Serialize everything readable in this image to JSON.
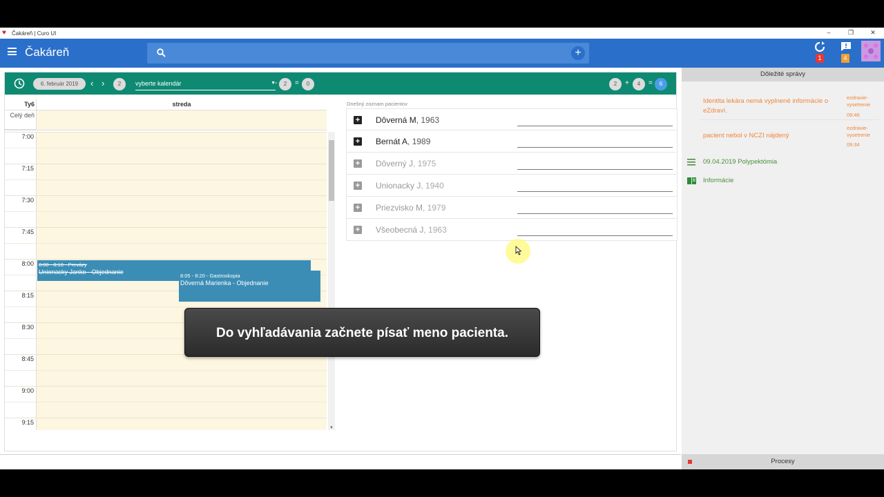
{
  "window": {
    "title": "Čakáreň | Curo UI",
    "controls": [
      "–",
      "❐",
      "✕"
    ]
  },
  "appbar": {
    "title": "Čakáreň",
    "search_placeholder": "",
    "sync_badge": "1",
    "messages_badge": "4"
  },
  "toolbar": {
    "date": "6. február 2019",
    "week_count": "2",
    "calendar_select": "vyberte kalendár",
    "filter_a": "2",
    "filter_eq": "0",
    "count_a": "2",
    "count_b": "4",
    "count_total": "6",
    "minus": "-",
    "equals": "=",
    "plus": "+"
  },
  "calendar": {
    "week_label": "Ty6",
    "day_label": "streda",
    "allday_label": "Celý deň",
    "times": [
      "7:00",
      "7:15",
      "7:30",
      "7:45",
      "8:00",
      "8:15",
      "8:30",
      "8:45",
      "9:00",
      "9:15"
    ],
    "events": [
      {
        "time": "8:00 - 8:10 - Prevázy",
        "name": "Unionacky Janko - Objednanie",
        "cancelled": true
      },
      {
        "time": "8:05 - 8:20 - Gastroskopia",
        "name": "Dôverná Marienka - Objednanie",
        "cancelled": false
      }
    ]
  },
  "patients": {
    "caption": "Dnešný zoznam pacientov",
    "items": [
      {
        "name": "Dôverná M",
        "year": ", 1963",
        "active": true
      },
      {
        "name": "Bernát A",
        "year": ", 1989",
        "active": true
      },
      {
        "name": "Dôverný J",
        "year": ", 1975",
        "active": false
      },
      {
        "name": "Unionacky J",
        "year": ", 1940",
        "active": false
      },
      {
        "name": "Priezvisko M",
        "year": ", 1979",
        "active": false
      },
      {
        "name": "Všeobecná J",
        "year": ", 1963",
        "active": false
      }
    ]
  },
  "messages": {
    "title": "Dôležité správy",
    "items": [
      {
        "text": "Identita lekára nemá vyplnené informácie o eZdraví.",
        "source": "ezdravie-vysetrenie",
        "time": "09:46"
      },
      {
        "text": "pacient nebol v NCZI nájdený",
        "source": "ezdravie-vysetrenie",
        "time": "09:34"
      }
    ],
    "links": [
      {
        "text": "09.04.2019 Polypektómia",
        "icon": "list-icon"
      },
      {
        "text": "Informácie",
        "icon": "book-icon"
      }
    ]
  },
  "footer": {
    "processes": "Procesy"
  },
  "overlay": {
    "caption": "Do vyhľadávania začnete písať meno pacienta."
  },
  "colors": {
    "appbar": "#2a6fc9",
    "toolbar": "#0f8a72",
    "event": "#3b8db5",
    "warning": "#f0853a",
    "link": "#4a8f3c"
  }
}
